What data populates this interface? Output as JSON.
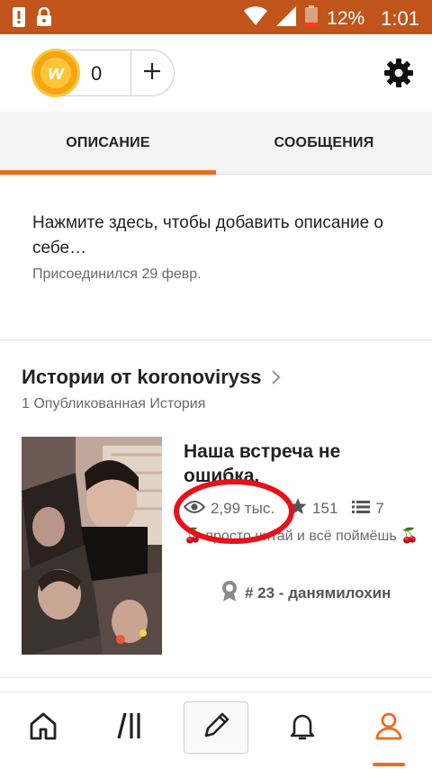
{
  "status_bar": {
    "battery_percent": "12%",
    "time": "1:01"
  },
  "wallet": {
    "coin_count": "0",
    "coin_letter": "w"
  },
  "tabs": [
    {
      "label": "ОПИСАНИЕ",
      "active": true
    },
    {
      "label": "СООБЩЕНИЯ",
      "active": false
    }
  ],
  "profile": {
    "description_prompt": "Нажмите здесь, чтобы добавить описание о себе…",
    "joined": "Присоединился 29 февр."
  },
  "stories": {
    "title": "Истории от koronoviryss",
    "count_label": "1 Опубликованная История",
    "items": [
      {
        "title": "Наша встреча не ошибка.",
        "views": "2,99 тыс.",
        "votes": "151",
        "parts": "7",
        "description_prefix": "🍒",
        "description": "просто читай и всё поймёшь",
        "description_suffix": "🍒",
        "rank": "# 23 - данямилохин"
      }
    ]
  },
  "icons": {
    "status_left": [
      "alert-icon",
      "lock-icon"
    ],
    "status_right": [
      "wifi-icon",
      "signal-icon",
      "battery-icon"
    ],
    "topbar": [
      "coin-icon",
      "plus-icon",
      "settings-gear-icon"
    ],
    "stats": [
      "eye-icon",
      "star-icon",
      "list-icon"
    ],
    "nav": [
      "home-icon",
      "browse-icon",
      "pencil-icon",
      "bell-icon",
      "profile-icon"
    ]
  },
  "colors": {
    "status_bar": "#c0541a",
    "accent": "#f26a1d",
    "annotation": "#e8101a",
    "coin": "#f6a513"
  },
  "annotation": {
    "shape": "red ellipse around view count"
  }
}
